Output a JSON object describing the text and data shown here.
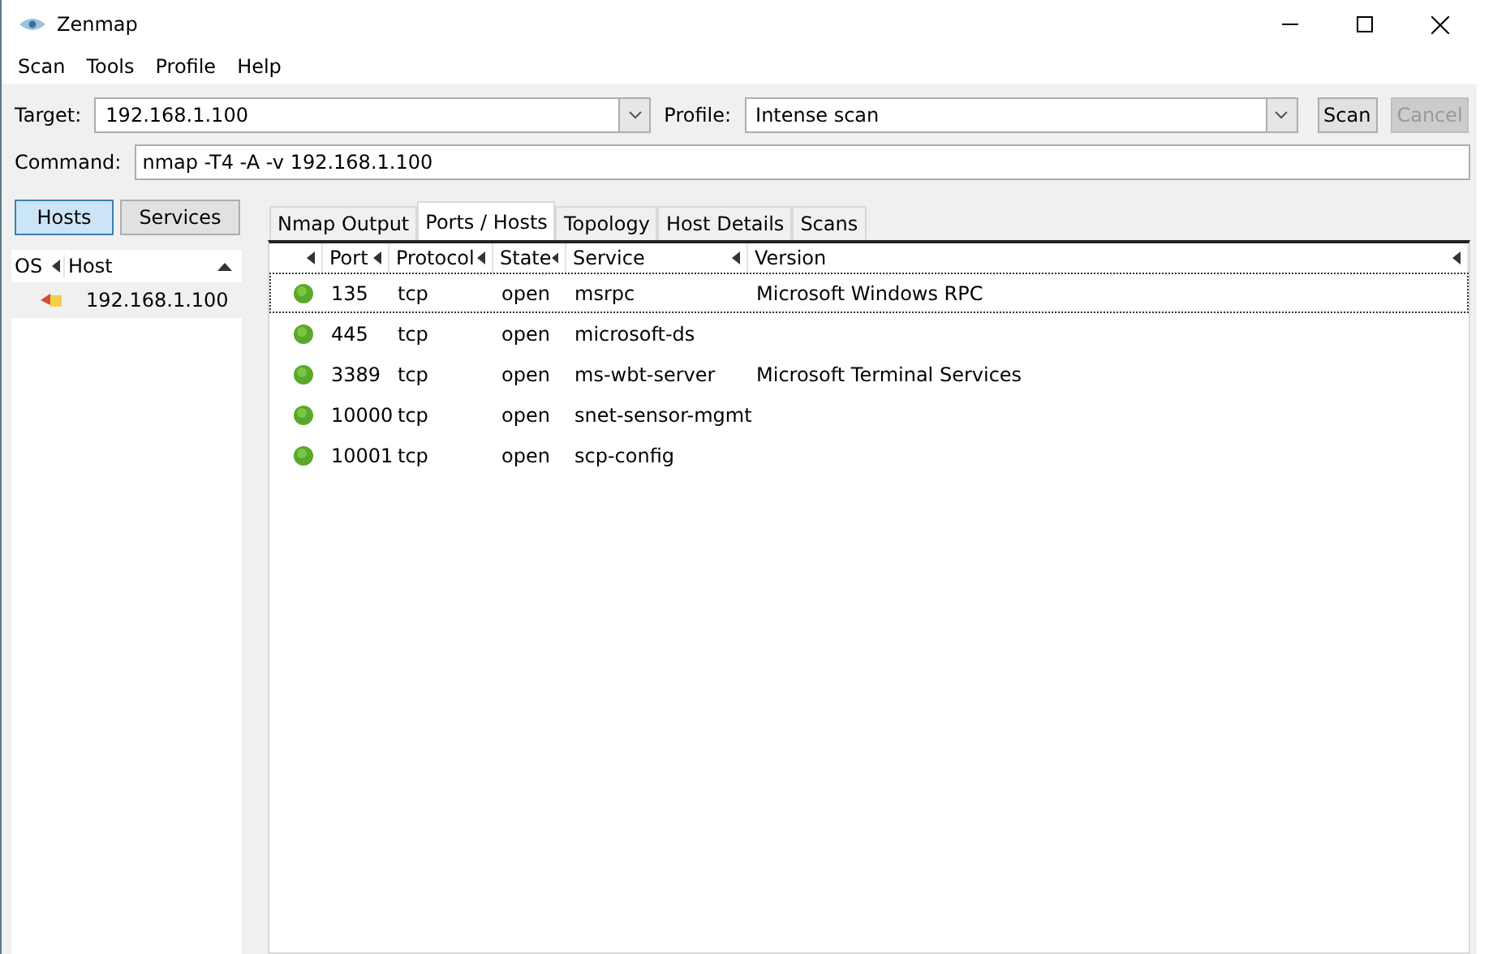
{
  "window": {
    "title": "Zenmap"
  },
  "menu": [
    "Scan",
    "Tools",
    "Profile",
    "Help"
  ],
  "target": {
    "label": "Target:",
    "value": "192.168.1.100"
  },
  "profile": {
    "label": "Profile:",
    "value": "Intense scan"
  },
  "buttons": [
    {
      "label": "Scan",
      "disabled": false
    },
    {
      "label": "Cancel",
      "disabled": true
    }
  ],
  "command": {
    "label": "Command:",
    "value": "nmap -T4 -A -v 192.168.1.100"
  },
  "view_toggle": [
    {
      "label": "Hosts",
      "selected": true
    },
    {
      "label": "Services",
      "selected": false
    }
  ],
  "host_list": {
    "columns": [
      "OS",
      "Host"
    ],
    "rows": [
      {
        "host": "192.168.1.100",
        "selected": false
      }
    ]
  },
  "tabs": [
    {
      "label": "Nmap Output",
      "selected": false
    },
    {
      "label": "Ports / Hosts",
      "selected": true
    },
    {
      "label": "Topology",
      "selected": false
    },
    {
      "label": "Host Details",
      "selected": false
    },
    {
      "label": "Scans",
      "selected": false
    }
  ],
  "table": {
    "columns": [
      "Port",
      "Protocol",
      "State",
      "Service",
      "Version"
    ],
    "rows": [
      {
        "cells": [
          "135",
          "tcp",
          "open",
          "msrpc",
          "Microsoft Windows RPC"
        ],
        "selected": true
      },
      {
        "cells": [
          "445",
          "tcp",
          "open",
          "microsoft-ds",
          ""
        ],
        "selected": false
      },
      {
        "cells": [
          "3389",
          "tcp",
          "open",
          "ms-wbt-server",
          "Microsoft Terminal Services"
        ],
        "selected": false
      },
      {
        "cells": [
          "10000",
          "tcp",
          "open",
          "snet-sensor-mgmt",
          ""
        ],
        "selected": false
      },
      {
        "cells": [
          "10001",
          "tcp",
          "open",
          "scp-config",
          ""
        ],
        "selected": false
      }
    ]
  }
}
